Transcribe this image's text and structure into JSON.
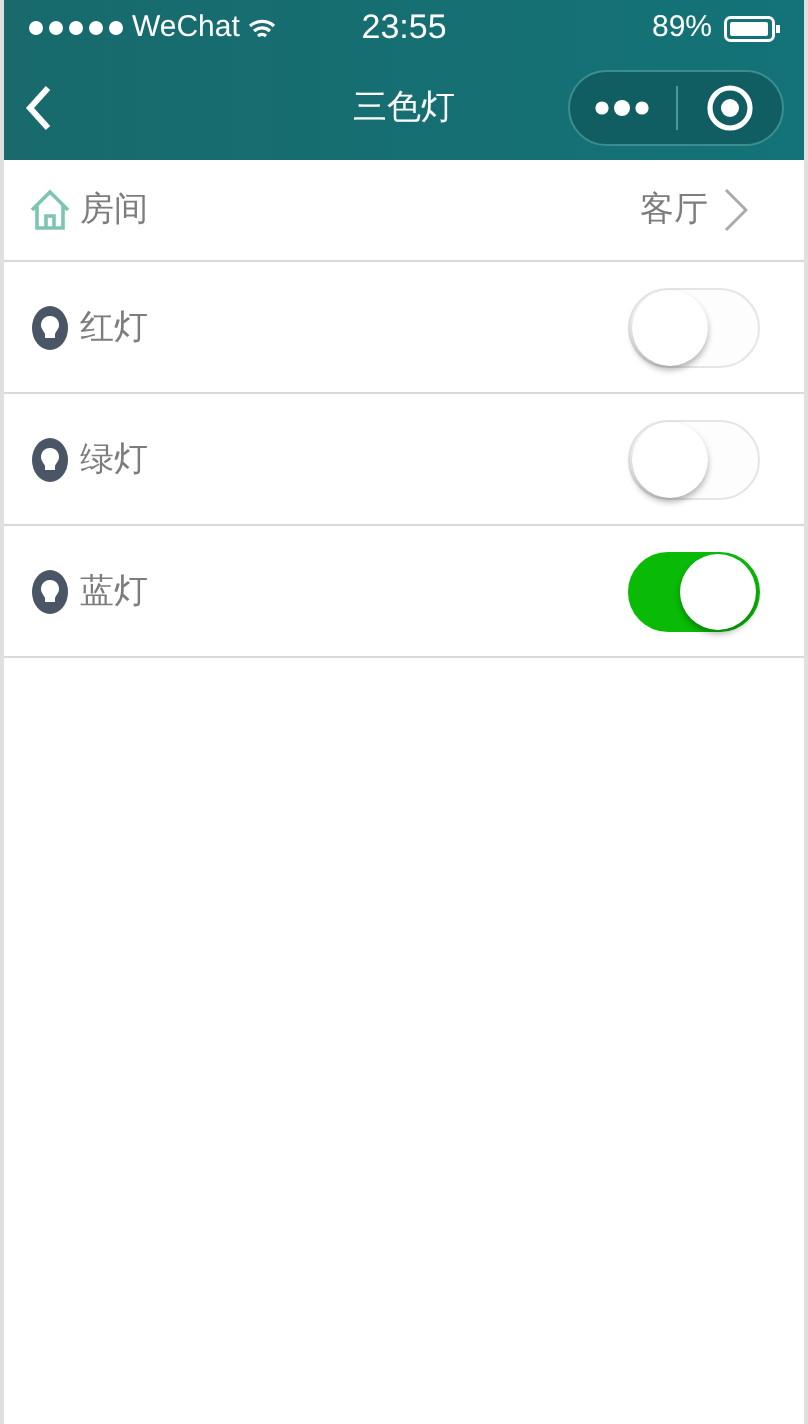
{
  "status_bar": {
    "carrier": "WeChat",
    "time": "23:55",
    "battery": "89%"
  },
  "nav_bar": {
    "title": "三色灯"
  },
  "room": {
    "label": "房间",
    "value": "客厅"
  },
  "lights": [
    {
      "name": "红灯",
      "on": false
    },
    {
      "name": "绿灯",
      "on": false
    },
    {
      "name": "蓝灯",
      "on": true
    }
  ]
}
